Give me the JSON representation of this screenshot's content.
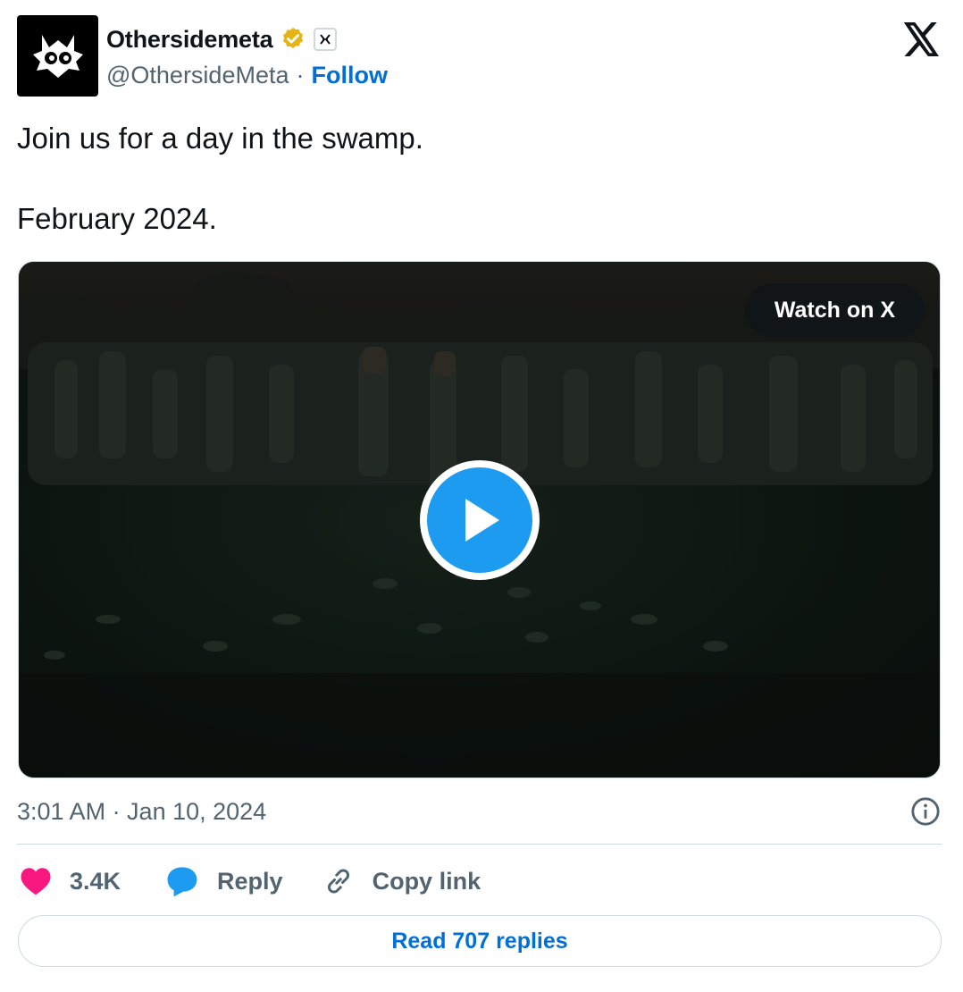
{
  "author": {
    "display_name": "Othersidemeta",
    "handle": "@OthersideMeta",
    "follow_label": "Follow",
    "separator": "·",
    "avatar_icon": "othersidemeta-logo-icon",
    "verified_color": "#e7b416"
  },
  "tweet": {
    "text": "Join us for a day in the swamp.\n\nFebruary 2024."
  },
  "media": {
    "watch_label": "Watch on X",
    "play_icon": "play-icon"
  },
  "meta": {
    "timestamp": "3:01 AM · Jan 10, 2024"
  },
  "actions": {
    "like_count": "3.4K",
    "reply_label": "Reply",
    "copy_label": "Copy link"
  },
  "footer": {
    "read_replies_label": "Read 707 replies"
  },
  "colors": {
    "accent": "#1d9bf0",
    "link": "#006fd6",
    "like": "#f91880",
    "muted": "#536471"
  }
}
